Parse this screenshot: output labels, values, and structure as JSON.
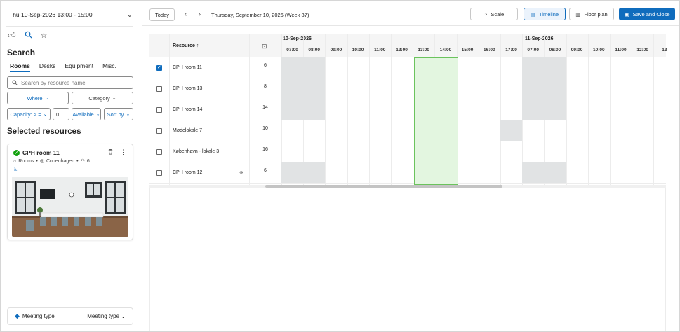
{
  "left": {
    "date_selector": "Thu 10-Sep-2026 13:00 - 15:00",
    "search_title": "Search",
    "tabs": [
      "Rooms",
      "Desks",
      "Equipment",
      "Misc."
    ],
    "search_placeholder": "Search by resource name",
    "filters": {
      "where": "Where",
      "category": "Category",
      "capacity": "Capacity: > =",
      "capacity_value": "0",
      "available": "Available",
      "sort_by": "Sort by"
    },
    "selected_title": "Selected resources",
    "card": {
      "name": "CPH room 11",
      "type": "Rooms",
      "location": "Copenhagen",
      "capacity": "6"
    },
    "meeting_type_label": "Meeting type",
    "meeting_type_value": "Meeting type"
  },
  "toolbar": {
    "today": "Today",
    "date_text": "Thursday, September 10, 2026 (Week 37)",
    "scale": "Scale",
    "timeline": "Timeline",
    "floor_plan": "Floor plan",
    "save_close": "Save and Close"
  },
  "grid": {
    "resource_header": "Resource ↑",
    "dates": [
      "10-Sep-2026",
      "11-Sep-2026"
    ],
    "hours_day1": [
      "07:00",
      "08:00",
      "09:00",
      "10:00",
      "11:00",
      "12:00",
      "13:00",
      "14:00",
      "15:00",
      "16:00",
      "17:00"
    ],
    "hours_day2": [
      "07:00",
      "08:00",
      "09:00",
      "10:00",
      "11:00",
      "12:00",
      "13"
    ],
    "rows": [
      {
        "name": "CPH room 11",
        "capacity": "6",
        "checked": true
      },
      {
        "name": "CPH room 13",
        "capacity": "8",
        "checked": false
      },
      {
        "name": "CPH room 14",
        "capacity": "14",
        "checked": false
      },
      {
        "name": "Mødelokale 7",
        "capacity": "10",
        "checked": false
      },
      {
        "name": "København - lokale 3",
        "capacity": "16",
        "checked": false
      },
      {
        "name": "CPH room 12",
        "capacity": "6",
        "checked": false
      }
    ]
  },
  "colors": {
    "accent": "#0f6cbd",
    "selection_fill": "#e3f6e0",
    "selection_border": "#6bc35d",
    "unavailable": "#e1e3e4"
  }
}
